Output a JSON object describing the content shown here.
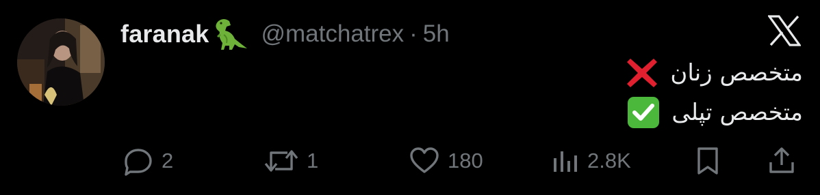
{
  "tweet": {
    "author": {
      "display_name": "faranak",
      "name_emoji": "t-rex-emoji",
      "handle": "@matchatrex",
      "separator": "·",
      "time": "5h",
      "avatar": "profile-photo"
    },
    "platform_logo": "x-logo",
    "lines": [
      {
        "text": "متخصص زنان",
        "mark": "cross-mark-emoji"
      },
      {
        "text": "متخصص تپلی",
        "mark": "check-mark-button-emoji"
      }
    ],
    "actions": {
      "replies": {
        "icon": "reply-icon",
        "count": "2"
      },
      "reposts": {
        "icon": "repost-icon",
        "count": "1"
      },
      "likes": {
        "icon": "heart-icon",
        "count": "180"
      },
      "views": {
        "icon": "views-icon",
        "count": "2.8K"
      },
      "bookmark": {
        "icon": "bookmark-icon"
      },
      "share": {
        "icon": "share-icon"
      }
    },
    "colors": {
      "background": "#000000",
      "primary_text": "#e7e9ea",
      "secondary_text": "#71767b",
      "cross": "#e0202e",
      "check_bg": "#4cb83b"
    }
  }
}
